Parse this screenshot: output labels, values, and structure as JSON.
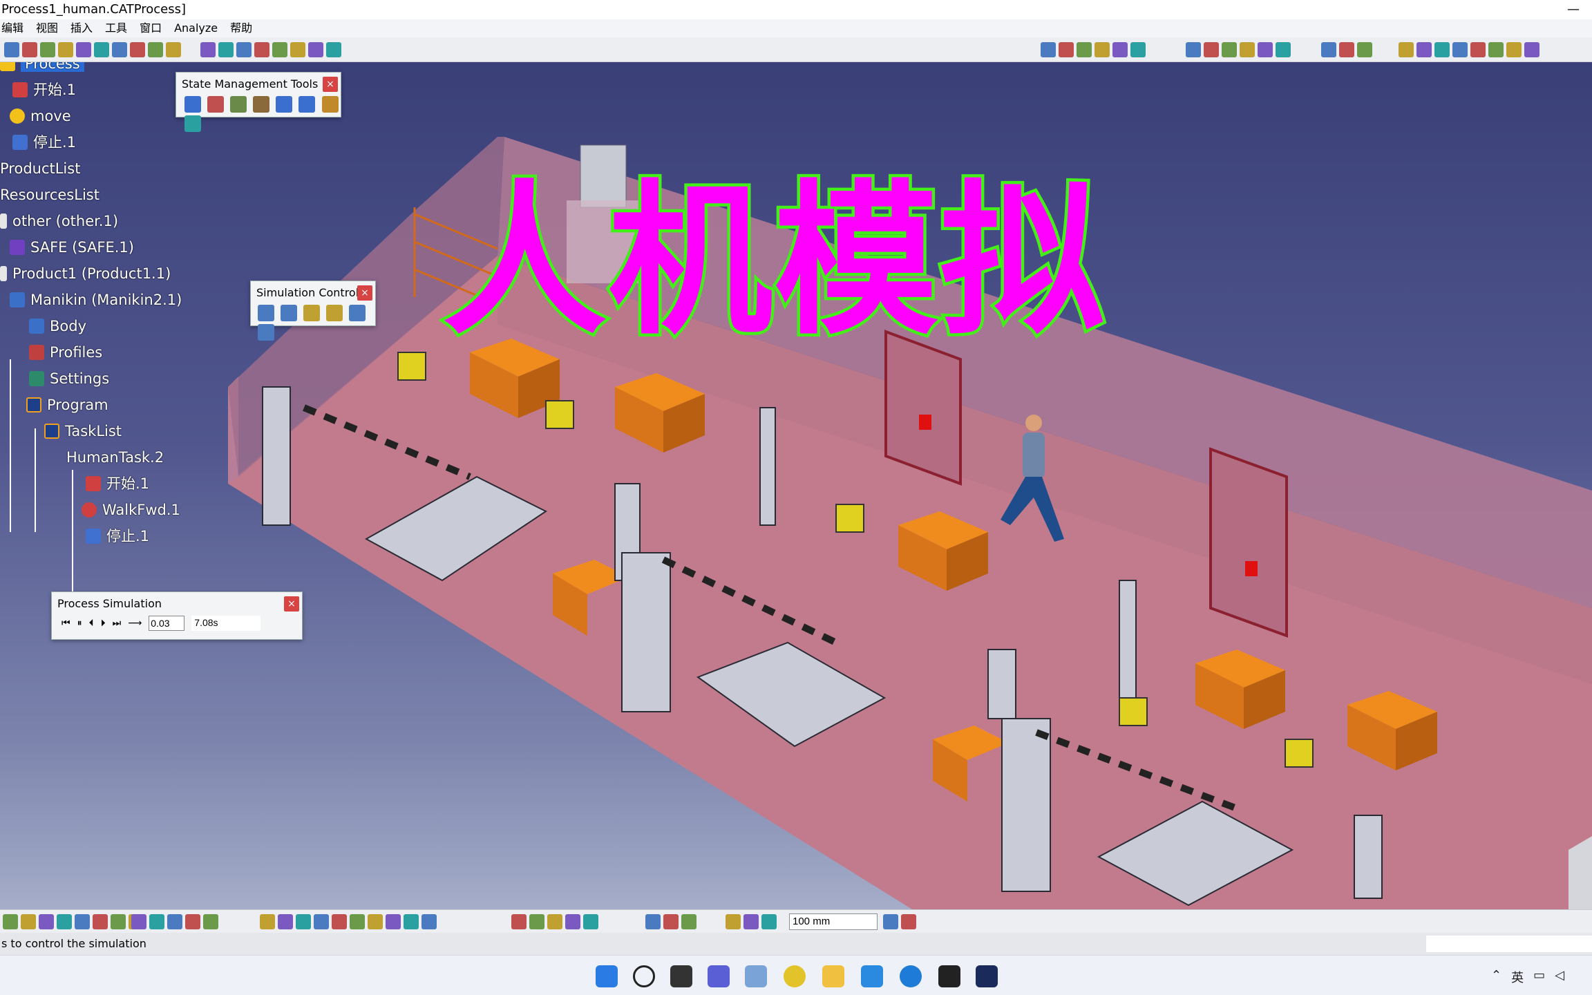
{
  "window": {
    "title": "Process1_human.CATProcess]",
    "minimize_glyph": "—"
  },
  "menu": [
    "编辑",
    "视图",
    "插入",
    "工具",
    "窗口",
    "Analyze",
    "帮助"
  ],
  "colors": {
    "viewport_top": "#3a3f78",
    "floor": "#c27b8c",
    "wall": "#b07a96",
    "table_orange": "#e88a1c",
    "title_fill": "#ff00ff",
    "title_stroke": "#44ee1a",
    "selection": "#2a6cd6"
  },
  "tree": [
    {
      "label": "Process",
      "icon": "process-icon",
      "selected": true
    },
    {
      "label": "开始.1",
      "icon": "start-icon"
    },
    {
      "label": "move",
      "icon": "move-icon"
    },
    {
      "label": "停止.1",
      "icon": "stop-icon"
    },
    {
      "label": "ProductList",
      "icon": ""
    },
    {
      "label": "ResourcesList",
      "icon": ""
    },
    {
      "label": "other (other.1)",
      "icon": "resource-icon"
    },
    {
      "label": "SAFE (SAFE.1)",
      "icon": "resource-icon"
    },
    {
      "label": "Product1 (Product1.1)",
      "icon": "product-icon"
    },
    {
      "label": "Manikin (Manikin2.1)",
      "icon": "manikin-icon"
    },
    {
      "label": "Body",
      "icon": "body-icon"
    },
    {
      "label": "Profiles",
      "icon": "profiles-icon"
    },
    {
      "label": "Settings",
      "icon": "settings-icon"
    },
    {
      "label": "Program",
      "icon": "program-icon"
    },
    {
      "label": "TaskList",
      "icon": "tasklist-icon"
    },
    {
      "label": "HumanTask.2",
      "icon": ""
    },
    {
      "label": "开始.1",
      "icon": "start-icon"
    },
    {
      "label": "WalkFwd.1",
      "icon": "walk-icon"
    },
    {
      "label": "停止.1",
      "icon": "stop-icon"
    }
  ],
  "panels": {
    "state": {
      "title": "State Management Tools",
      "close": "×"
    },
    "simctl": {
      "title": "Simulation Control...",
      "close": "×"
    },
    "procsim": {
      "title": "Process Simulation",
      "close": "×",
      "step_value": "0.03",
      "time_value": "7.08s",
      "arrow": "⟶"
    }
  },
  "overlay_title": "人机模拟",
  "bottom": {
    "zoom_value": "100 mm"
  },
  "status": {
    "text": "s to control the simulation"
  },
  "tray": {
    "lang": "英"
  }
}
